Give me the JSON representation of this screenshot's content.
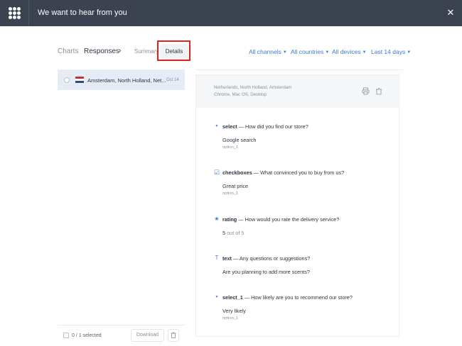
{
  "header": {
    "title": "We want to hear from you"
  },
  "nav": {
    "charts": "Charts",
    "responses": "Responses",
    "chevron": "›",
    "summary": "Summary",
    "details": "Details"
  },
  "filters": [
    {
      "label": "All channels"
    },
    {
      "label": "All countries"
    },
    {
      "label": "All devices"
    },
    {
      "label": "Last 14 days"
    }
  ],
  "responses": [
    {
      "location": "Amsterdam, North Holland, Net...",
      "date": "Oct 14",
      "flag": "netherlands-flag-icon"
    }
  ],
  "footer": {
    "selected": "0 / 1 selected",
    "download": "Download"
  },
  "detail": {
    "location": "Netherlands, North Holland, Amsterdam",
    "device": "Chrome, Mac OS, Desktop",
    "questions": [
      {
        "icon": "select-caret-icon",
        "glyph": "▼",
        "field": "select",
        "question": " — How did you find our store?",
        "answer": "Google search",
        "value": "option_1"
      },
      {
        "icon": "checkbox-icon",
        "glyph": "☑",
        "field": "checkboxes",
        "question": " — What convinced you to buy from us?",
        "answer": "Great price",
        "value": "option_1"
      },
      {
        "icon": "star-icon",
        "glyph": "★",
        "field": "rating",
        "question": " — How would you rate the delivery service?",
        "answer": "5",
        "answer_suffix": " out of 5",
        "value": ""
      },
      {
        "icon": "text-icon",
        "glyph": "T",
        "field": "text",
        "question": " — Any questions or suggestions?",
        "answer": "Are you planning to add more scents?",
        "value": ""
      },
      {
        "icon": "select-caret-icon",
        "glyph": "▼",
        "field": "select_1",
        "question": " — How likely are you to recommend our store?",
        "answer": "Very likely",
        "value": "option_1"
      }
    ]
  },
  "colors": {
    "topbar": "#3b4250",
    "accent": "#3b7bd4",
    "highlight": "#e32020",
    "selected_row": "#e6ecf6"
  }
}
